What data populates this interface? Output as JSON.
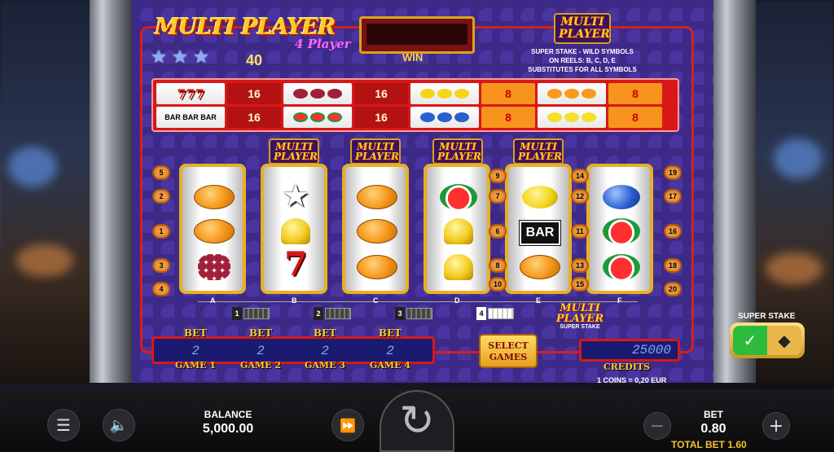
{
  "game": {
    "logo_title": "MULTI PLAYER",
    "logo_subtitle": "4 Player",
    "stars_value": "40",
    "win_label": "WIN",
    "small_logo": "MULTI PLAYER",
    "info_lines": [
      "SUPER STAKE - WILD SYMBOLS",
      "ON REELS: B, C, D, E",
      "SUBSTITUTES FOR ALL SYMBOLS"
    ],
    "paytable": [
      [
        {
          "symbol": "777",
          "value": "16"
        },
        {
          "symbol": "grapes",
          "value": "16"
        },
        {
          "symbol": "lemons",
          "value": "8"
        },
        {
          "symbol": "oranges",
          "value": "8"
        }
      ],
      [
        {
          "symbol": "BAR BAR BAR",
          "value": "16"
        },
        {
          "symbol": "melons",
          "value": "16"
        },
        {
          "symbol": "plums",
          "value": "8"
        },
        {
          "symbol": "lemons-yellow",
          "value": "8"
        }
      ]
    ],
    "reel_letters": [
      "A",
      "B",
      "C",
      "D",
      "E",
      "F"
    ],
    "reels": [
      [
        "orange",
        "orange",
        "grapes"
      ],
      [
        "star",
        "bell",
        "seven"
      ],
      [
        "orange",
        "orange",
        "orange"
      ],
      [
        "melon",
        "bell",
        "bell"
      ],
      [
        "lemon",
        "BAR",
        "orange"
      ],
      [
        "plum",
        "melon",
        "melon"
      ]
    ],
    "line_numbers": {
      "left": [
        "5",
        "2",
        "1",
        "3",
        "4"
      ],
      "between_de_left": [
        "9",
        "7",
        "6",
        "8",
        "10"
      ],
      "between_de_right": [
        "14",
        "12",
        "11",
        "13",
        "15"
      ],
      "right": [
        "19",
        "17",
        "16",
        "18",
        "20"
      ]
    },
    "game_selectors": [
      {
        "num": "1",
        "active": false
      },
      {
        "num": "2",
        "active": false
      },
      {
        "num": "3",
        "active": false
      },
      {
        "num": "4",
        "active": true
      }
    ],
    "super_stake_logo": "MULTI PLAYER",
    "super_stake_text": "SUPER STAKE",
    "bets": [
      {
        "label": "BET",
        "value": "2",
        "game": "GAME 1"
      },
      {
        "label": "BET",
        "value": "2",
        "game": "GAME 2"
      },
      {
        "label": "BET",
        "value": "2",
        "game": "GAME 3"
      },
      {
        "label": "BET",
        "value": "2",
        "game": "GAME 4"
      }
    ],
    "select_games": "SELECT GAMES",
    "credits_value": "25000",
    "credits_label": "CREDITS",
    "coins_note": "1 COINS = 0,20 EUR"
  },
  "super_stake": {
    "label": "SUPER STAKE",
    "on_icon": "✓",
    "off_icon": "◆"
  },
  "bottom": {
    "balance_label": "BALANCE",
    "balance_value": "5,000.00",
    "bet_label": "BET",
    "bet_value": "0.80",
    "total_bet": "TOTAL BET  1.60"
  }
}
